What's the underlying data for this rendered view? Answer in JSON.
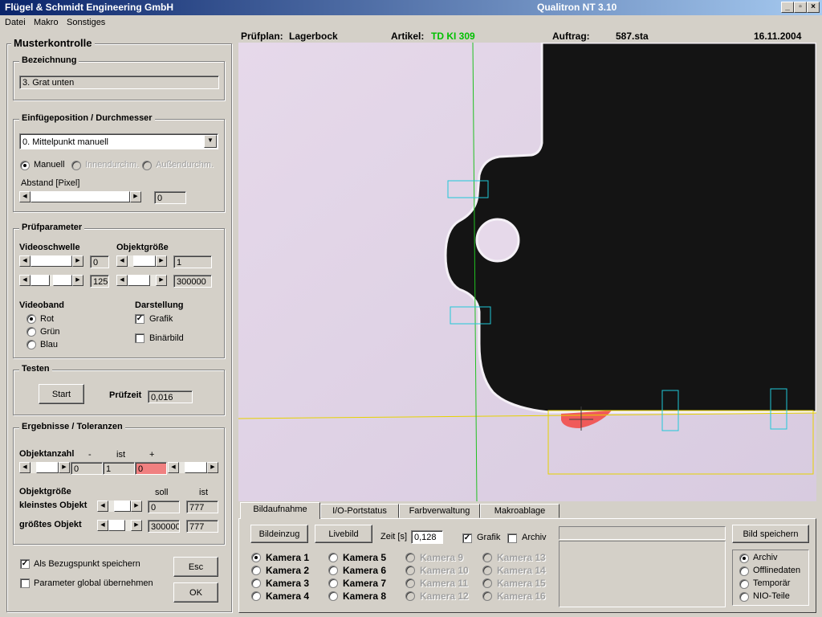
{
  "window": {
    "title_left": "Flügel & Schmidt  Engineering GmbH",
    "title_right": "Qualitron NT  3.10",
    "buttons": {
      "min": "_",
      "max": "▫",
      "close": "×"
    }
  },
  "menu": [
    "Datei",
    "Makro",
    "Sonstiges"
  ],
  "left_panel": {
    "title": "Musterkontrolle",
    "bezeichnung": {
      "title": "Bezeichnung",
      "value": "3.  Grat unten"
    },
    "einfuege": {
      "title": "Einfügeposition / Durchmesser",
      "select_value": "0. Mittelpunkt manuell",
      "radios": [
        "Manuell",
        "Innendurchm.",
        "Außendurchm."
      ],
      "abstand_label": "Abstand [Pixel]",
      "abstand_value": "0"
    },
    "pruefparameter": {
      "title": "Prüfparameter",
      "videoschwelle_label": "Videoschwelle",
      "objektgroesse_label": "Objektgröße",
      "vs_min": "0",
      "vs_max": "125",
      "og_min": "1",
      "og_max": "300000",
      "videoband_label": "Videoband",
      "videoband": [
        "Rot",
        "Grün",
        "Blau"
      ],
      "darstellung_label": "Darstellung",
      "darstellung": [
        "Grafik",
        "Binärbild"
      ]
    },
    "testen": {
      "title": "Testen",
      "start": "Start",
      "pruefzeit_label": "Prüfzeit",
      "pruefzeit_value": "0,016"
    },
    "ergebnisse": {
      "title": "Ergebnisse / Toleranzen",
      "objektanzahl_label": "Objektanzahl",
      "minus": "-",
      "ist": "ist",
      "plus": "+",
      "anz_min": "0",
      "anz_ist": "1",
      "anz_max": "0",
      "objektgroesse_label": "Objektgröße",
      "soll": "soll",
      "ist2": "ist",
      "kleinstes_label": "kleinstes Objekt",
      "kleinstes_soll": "0",
      "kleinstes_ist": "777",
      "groesstes_label": "größtes Objekt",
      "groesstes_soll": "300000",
      "groesstes_ist": "777"
    },
    "bezugspunkt": "Als Bezugspunkt speichern",
    "parameter_global": "Parameter global übernehmen",
    "esc": "Esc",
    "ok": "OK"
  },
  "info": {
    "pruefplan_label": "Prüfplan:",
    "pruefplan": "Lagerbock",
    "artikel_label": "Artikel:",
    "artikel": "TD KI 309",
    "auftrag_label": "Auftrag:",
    "auftrag": "587.sta",
    "date": "16.11.2004",
    "artikel_color": "#00c000"
  },
  "tabs": [
    "Bildaufnahme",
    "I/O-Portstatus",
    "Farbverwaltung",
    "Makroablage"
  ],
  "bottom": {
    "bildeinzug": "Bildeinzug",
    "livebild": "Livebild",
    "zeit_label": "Zeit [s]",
    "zeit_value": "0,128",
    "grafik": "Grafik",
    "archiv": "Archiv",
    "bild_speichern": "Bild speichern",
    "kameras": [
      "Kamera 1",
      "Kamera 2",
      "Kamera 3",
      "Kamera 4",
      "Kamera 5",
      "Kamera 6",
      "Kamera 7",
      "Kamera 8",
      "Kamera 9",
      "Kamera 10",
      "Kamera 11",
      "Kamera 12",
      "Kamera 13",
      "Kamera 14",
      "Kamera 15",
      "Kamera 16"
    ],
    "storage": [
      "Archiv",
      "Offlinedaten",
      "Temporär",
      "NIO-Teile"
    ]
  }
}
